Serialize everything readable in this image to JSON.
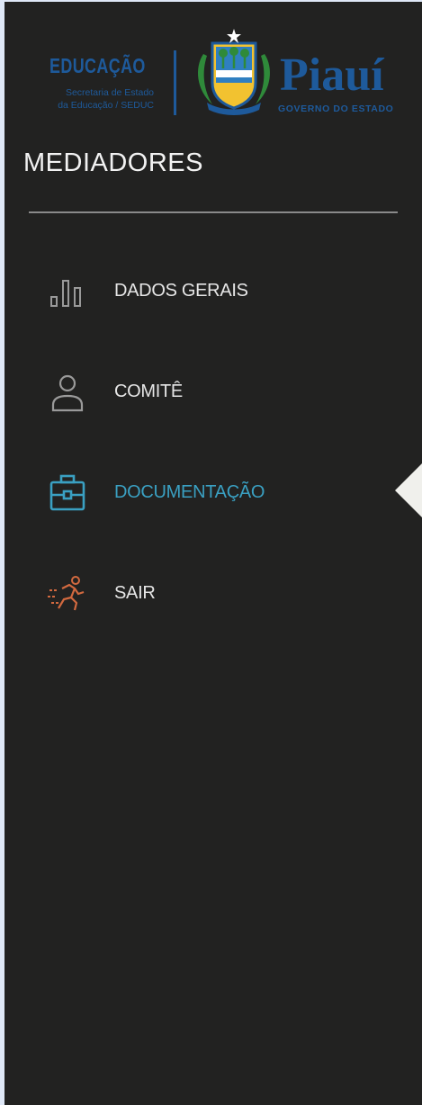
{
  "logo": {
    "edu_title": "EDUCAÇÃO",
    "edu_subtitle_line1": "Secretaria de Estado",
    "edu_subtitle_line2": "da Educação / SEDUC",
    "brand_title": "Piauí",
    "brand_subtitle": "GOVERNO DO ESTADO"
  },
  "sidebar": {
    "title": "MEDIADORES",
    "items": [
      {
        "label": "DADOS GERAIS",
        "icon": "bar-chart-icon",
        "active": false
      },
      {
        "label": "COMITÊ",
        "icon": "user-icon",
        "active": false
      },
      {
        "label": "DOCUMENTAÇÃO",
        "icon": "briefcase-icon",
        "active": true
      },
      {
        "label": "SAIR",
        "icon": "running-person-icon",
        "active": false
      }
    ]
  },
  "colors": {
    "sidebar_bg": "#222221",
    "brand_blue": "#1e5a9b",
    "active": "#3aa0c2",
    "exit_icon": "#d2693f",
    "text": "#e6e6e6"
  }
}
